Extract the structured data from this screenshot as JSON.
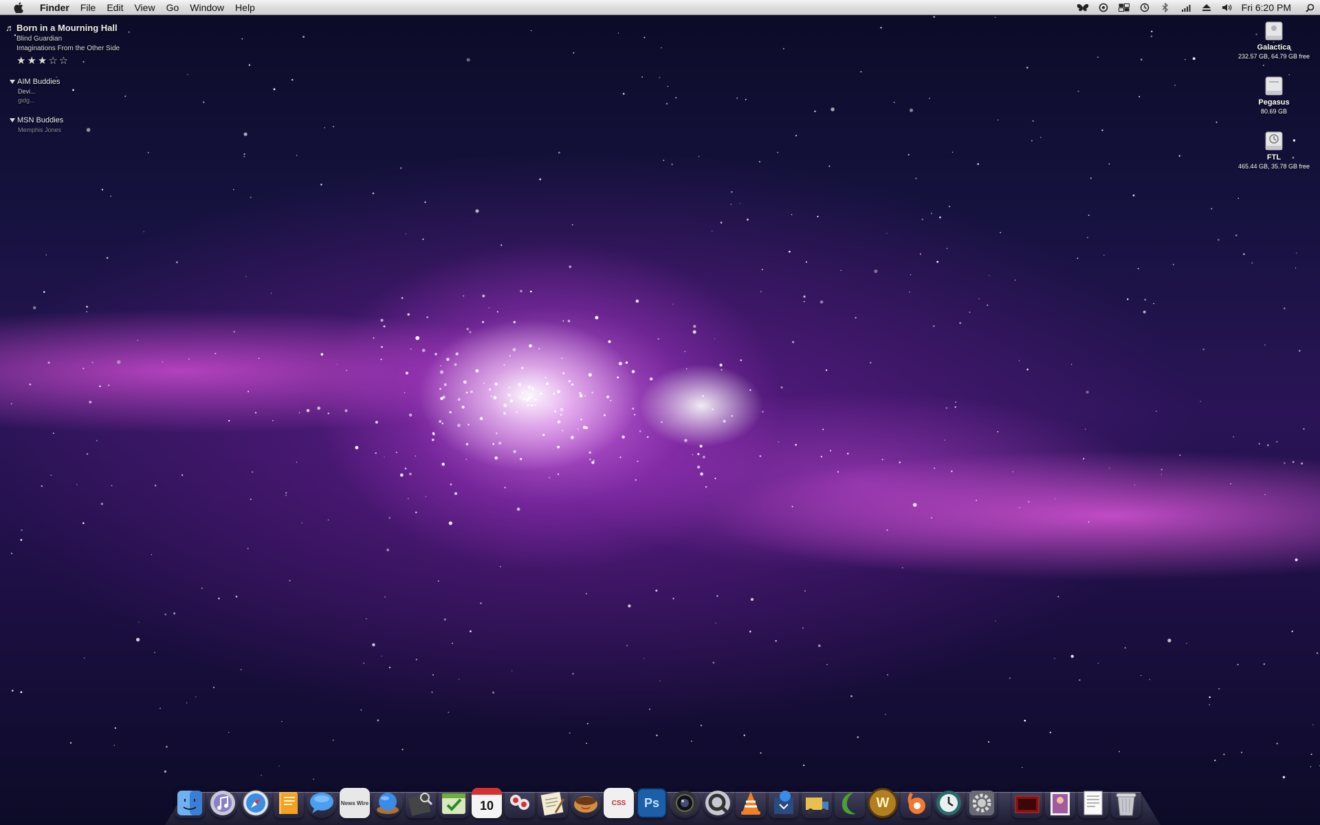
{
  "menubar": {
    "app_name": "Finder",
    "menus": [
      "File",
      "Edit",
      "View",
      "Go",
      "Window",
      "Help"
    ],
    "clock": "Fri 6:20 PM",
    "extras": [
      "butterfly-icon",
      "screen-sharing-icon",
      "spaces-icon",
      "time-machine-icon",
      "bluetooth-icon",
      "wifi-icon",
      "eject-icon",
      "volume-icon"
    ]
  },
  "now_playing": {
    "track": "Born in a Mourning Hall",
    "artist": "Blind Guardian",
    "album": "Imaginations From the Other Side",
    "rating": "★★★☆☆",
    "rating_value": 3,
    "rating_max": 5
  },
  "aim": {
    "title": "AIM Buddies",
    "buddies": [
      "Devi...",
      "gidg..."
    ]
  },
  "msn": {
    "title": "MSN Buddies",
    "buddies": [
      "Memphis Jones"
    ]
  },
  "drives": [
    {
      "name": "Galactica",
      "info": "232.57 GB, 64.79 GB free"
    },
    {
      "name": "Pegasus",
      "info": "80.69 GB"
    },
    {
      "name": "FTL",
      "info": "465.44 GB, 35.78 GB free"
    }
  ],
  "dock": {
    "icons": [
      {
        "id": "finder-icon",
        "color": "#4a8ee0"
      },
      {
        "id": "itunes-icon",
        "color": "#7a7fb8"
      },
      {
        "id": "safari-icon",
        "color": "#2f7fd0"
      },
      {
        "id": "pages-icon",
        "color": "#f0a020"
      },
      {
        "id": "ichat-icon",
        "color": "#3a8ce8"
      },
      {
        "id": "newsfire-icon",
        "color": "#cfcfcf"
      },
      {
        "id": "camino-icon",
        "color": "#2a6fd0"
      },
      {
        "id": "preview-icon",
        "color": "#5a5a62"
      },
      {
        "id": "things-icon",
        "color": "#6fae3a"
      },
      {
        "id": "ical-icon",
        "color": "#f2f2f2"
      },
      {
        "id": "pixelmator-icon",
        "color": "#d84040"
      },
      {
        "id": "textedit-icon",
        "color": "#d8c070"
      },
      {
        "id": "coffee-icon",
        "color": "#c08030"
      },
      {
        "id": "cssedit-icon",
        "color": "#e04848"
      },
      {
        "id": "photoshop-icon",
        "color": "#1c5ea8"
      },
      {
        "id": "aperture-icon",
        "color": "#2a2a36"
      },
      {
        "id": "quicktime-icon",
        "color": "#9a9aa8"
      },
      {
        "id": "vlc-icon",
        "color": "#f08020"
      },
      {
        "id": "cyberduck-icon",
        "color": "#3060a0"
      },
      {
        "id": "transmit-icon",
        "color": "#d8b040"
      },
      {
        "id": "growl-icon",
        "color": "#4aa030"
      },
      {
        "id": "warcraft-icon",
        "color": "#b08020"
      },
      {
        "id": "adium-icon",
        "color": "#f07030"
      },
      {
        "id": "time-machine-icon",
        "color": "#3a8a8a"
      },
      {
        "id": "system-preferences-icon",
        "color": "#7a7a86"
      },
      {
        "id": "photobooth-stack-icon",
        "color": "#8a1010"
      },
      {
        "id": "pictures-stack-icon",
        "color": "#a05aa0"
      },
      {
        "id": "documents-stack-icon",
        "color": "#e8e8e8"
      },
      {
        "id": "trash-icon",
        "color": "#b8b8c0"
      }
    ],
    "labels": {
      "newsfire": "News Wire",
      "ical_day": "10",
      "cssedit": "CSS",
      "photoshop": "Ps"
    }
  }
}
